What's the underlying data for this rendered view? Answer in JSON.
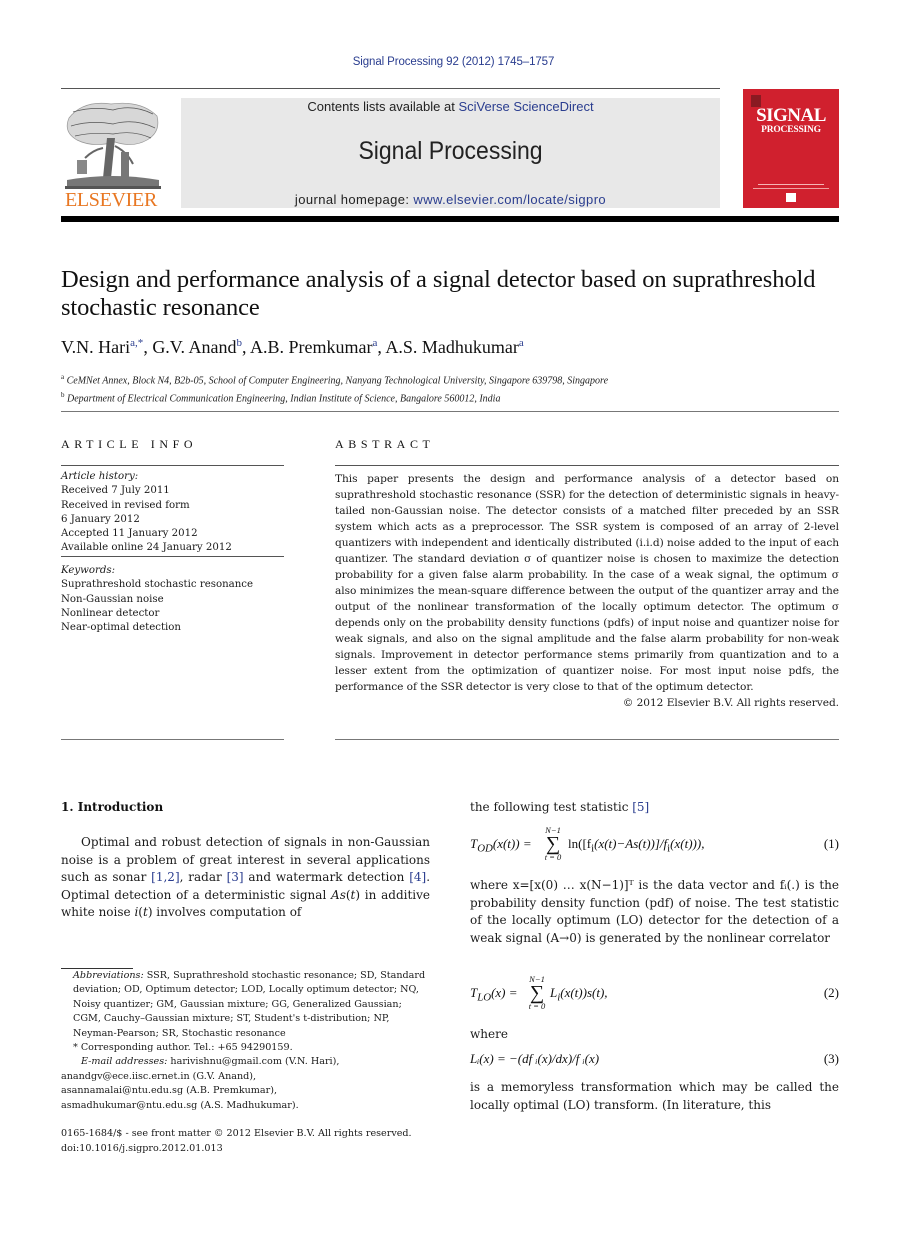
{
  "journal_ref": "Signal Processing 92 (2012) 1745–1757",
  "header": {
    "contents_prefix": "Contents lists available at ",
    "contents_link": "SciVerse ScienceDirect",
    "journal_name": "Signal Processing",
    "homepage_prefix": "journal homepage: ",
    "homepage_link": "www.elsevier.com/locate/sigpro",
    "publisher_logo_text": "ELSEVIER",
    "cover_title_line1": "SIGNAL",
    "cover_title_line2": "PROCESSING",
    "colors": {
      "link": "#2a3d8f",
      "elsevier_orange": "#e87722",
      "cover_red": "#d0202e",
      "header_box_gray": "#e8e8e8"
    }
  },
  "article": {
    "title": "Design and performance analysis of a signal detector based on suprathreshold stochastic resonance",
    "authors": [
      {
        "name": "V.N. Hari",
        "sup": "a,*"
      },
      {
        "name": "G.V. Anand",
        "sup": "b"
      },
      {
        "name": "A.B. Premkumar",
        "sup": "a"
      },
      {
        "name": "A.S. Madhukumar",
        "sup": "a"
      }
    ],
    "affiliations": [
      {
        "mark": "a",
        "text": "CeMNet Annex, Block N4, B2b-05, School of Computer Engineering, Nanyang Technological University, Singapore 639798, Singapore"
      },
      {
        "mark": "b",
        "text": "Department of Electrical Communication Engineering, Indian Institute of Science, Bangalore 560012, India"
      }
    ]
  },
  "article_info": {
    "label": "ARTICLE INFO",
    "history_head": "Article history:",
    "history": [
      "Received 7 July 2011",
      "Received in revised form",
      "6 January 2012",
      "Accepted 11 January 2012",
      "Available online 24 January 2012"
    ],
    "keywords_head": "Keywords:",
    "keywords": [
      "Suprathreshold stochastic resonance",
      "Non-Gaussian noise",
      "Nonlinear detector",
      "Near-optimal detection"
    ]
  },
  "abstract": {
    "label": "ABSTRACT",
    "text": "This paper presents the design and performance analysis of a detector based on suprathreshold stochastic resonance (SSR) for the detection of deterministic signals in heavy-tailed non-Gaussian noise. The detector consists of a matched filter preceded by an SSR system which acts as a preprocessor. The SSR system is composed of an array of 2-level quantizers with independent and identically distributed (i.i.d) noise added to the input of each quantizer. The standard deviation σ of quantizer noise is chosen to maximize the detection probability for a given false alarm probability. In the case of a weak signal, the optimum σ also minimizes the mean-square difference between the output of the quantizer array and the output of the nonlinear transformation of the locally optimum detector. The optimum σ depends only on the probability density functions (pdfs) of input noise and quantizer noise for weak signals, and also on the signal amplitude and the false alarm probability for non-weak signals. Improvement in detector performance stems primarily from quantization and to a lesser extent from the optimization of quantizer noise. For most input noise pdfs, the performance of the SSR detector is very close to that of the optimum detector.",
    "copyright": "© 2012 Elsevier B.V. All rights reserved."
  },
  "introduction": {
    "heading": "1.  Introduction",
    "para_parts": [
      "Optimal and robust detection of signals in non-Gaussian noise is a problem of great interest in several applications such as sonar ",
      "[1,2]",
      ", radar ",
      "[3]",
      " and watermark detection ",
      "[4]",
      ". Optimal detection of a deterministic signal ",
      "As",
      "(",
      "t",
      ") in additive white noise ",
      "i",
      "(",
      "t",
      ") involves computation of"
    ]
  },
  "footnotes": {
    "abbrev_head": "Abbreviations:",
    "abbrev_text": " SSR, Suprathreshold stochastic resonance; SD, Standard deviation; OD, Optimum detector; LOD, Locally optimum detector; NQ, Noisy quantizer; GM, Gaussian mixture; GG, Generalized Gaussian; CGM, Cauchy–Gaussian mixture; ST, Student's t-distribution; NP, Neyman-Pearson; SR, Stochastic resonance",
    "corresponding": "* Corresponding author. Tel.: +65 94290159.",
    "email_head": "E-mail addresses:",
    "emails": [
      " harivishnu@gmail.com (V.N. Hari),",
      "anandgv@ece.iisc.ernet.in (G.V. Anand),",
      "asannamalai@ntu.edu.sg (A.B. Premkumar),",
      "asmadhukumar@ntu.edu.sg (A.S. Madhukumar)."
    ],
    "front_matter": "0165-1684/$ - see front matter © 2012 Elsevier B.V. All rights reserved.",
    "doi": "doi:10.1016/j.sigpro.2012.01.013"
  },
  "right_column": {
    "lead_text": "the following test statistic ",
    "lead_cite": "[5]",
    "eq1": {
      "lhs": "T",
      "lhs_sub": "OD",
      "lhs_arg": "(x(t)) =",
      "sum_top": "N−1",
      "sum_bot": "t = 0",
      "rhs": "ln([f",
      "rhs_sub": "i",
      "rhs2": "(x(t)−As(t))]/f",
      "rhs2_sub": "i",
      "rhs3": "(x(t))),",
      "number": "(1)"
    },
    "para2": "where x=[x(0) … x(N−1)]ᵀ is the data vector and fᵢ(.) is the probability density function (pdf) of noise. The test statistic of the locally optimum (LO) detector for the detection of a weak signal (A→0) is generated by the nonlinear correlator",
    "eq2": {
      "lhs": "T",
      "lhs_sub": "LO",
      "lhs_arg": "(x) =",
      "sum_top": "N−1",
      "sum_bot": "t = 0",
      "rhs": "L",
      "rhs_sub": "i",
      "rhs2": "(x(t))s(t),",
      "number": "(2)"
    },
    "where": "where",
    "eq3": {
      "text": "Lᵢ(x) = −(df ᵢ(x)/dx)/f ᵢ(x)",
      "number": "(3)"
    },
    "para3": "is a memoryless transformation which may be called the locally optimal (LO) transform. (In literature, this"
  }
}
